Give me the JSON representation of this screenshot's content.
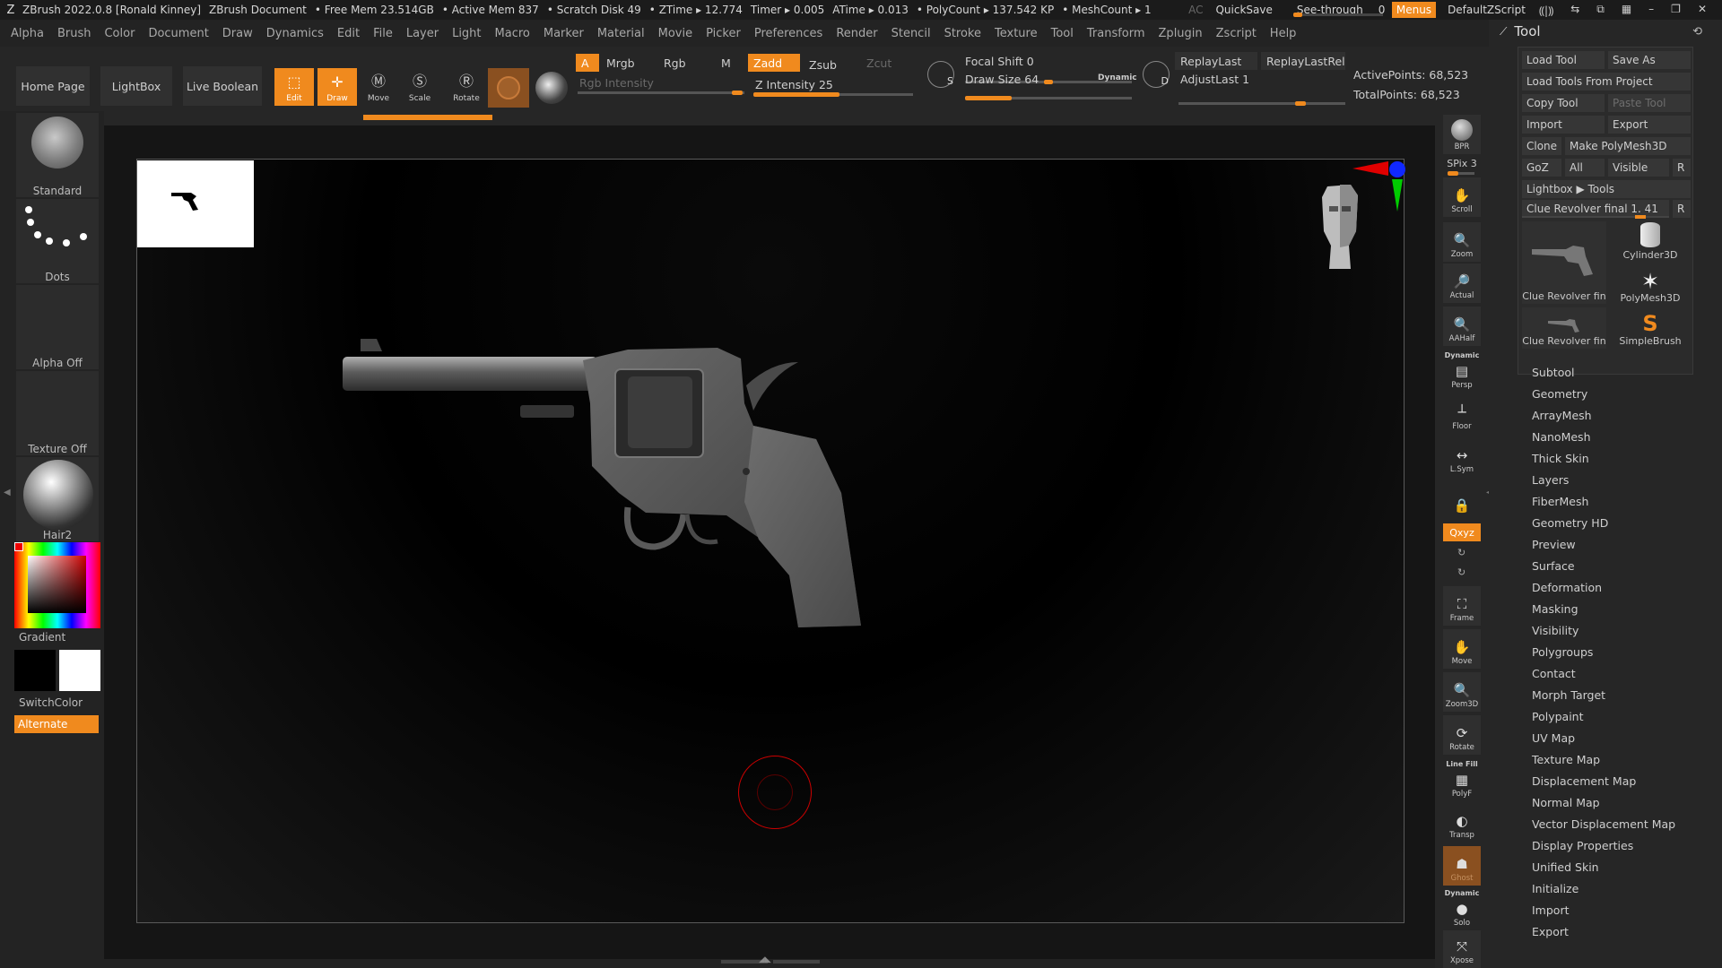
{
  "titlebar": {
    "app": "ZBrush 2022.0.8 [Ronald Kinney]",
    "document": "ZBrush Document",
    "free_mem": "• Free Mem 23.514GB",
    "active_mem": "• Active Mem 837",
    "scratch_disk": "• Scratch Disk 49",
    "ztime": "• ZTime ▸ 12.774",
    "timer": "Timer ▸ 0.005",
    "atime": "ATime ▸ 0.013",
    "polycount": "• PolyCount ▸ 137.542 KP",
    "meshcount": "• MeshCount ▸ 1",
    "ac": "AC",
    "quicksave": "QuickSave",
    "see_through_label": "See-through",
    "see_through_value": "0",
    "menus": "Menus",
    "zscript": "DefaultZScript"
  },
  "menubar": [
    "Alpha",
    "Brush",
    "Color",
    "Document",
    "Draw",
    "Dynamics",
    "Edit",
    "File",
    "Layer",
    "Light",
    "Macro",
    "Marker",
    "Material",
    "Movie",
    "Picker",
    "Preferences",
    "Render",
    "Stencil",
    "Stroke",
    "Texture",
    "Tool",
    "Transform",
    "Zplugin",
    "Zscript",
    "Help"
  ],
  "shelf": {
    "home_page": "Home Page",
    "lightbox": "LightBox",
    "live_boolean": "Live Boolean",
    "edit": "Edit",
    "draw": "Draw",
    "move": "Move",
    "scale": "Scale",
    "rotate": "Rotate",
    "a": "A",
    "mrgb": "Mrgb",
    "rgb": "Rgb",
    "m": "M",
    "zadd": "Zadd",
    "zsub": "Zsub",
    "zcut": "Zcut",
    "rgb_intensity": "Rgb Intensity",
    "z_intensity_label": "Z Intensity",
    "z_intensity": "25",
    "focal_shift_label": "Focal Shift",
    "focal_shift": "0",
    "draw_size_label": "Draw Size",
    "draw_size": "64",
    "dynamic": "Dynamic",
    "replay_last": "ReplayLast",
    "replay_last_rel": "ReplayLastRel",
    "adjust_last_label": "AdjustLast",
    "adjust_last": "1",
    "active_points": "ActivePoints: 68,523",
    "total_points": "TotalPoints: 68,523",
    "s_key": "S",
    "d_key": "D"
  },
  "left": {
    "brush": "Standard",
    "stroke": "Dots",
    "alpha": "Alpha Off",
    "texture": "Texture Off",
    "material": "Hair2",
    "gradient": "Gradient",
    "switch_color": "SwitchColor",
    "alternate": "Alternate"
  },
  "right_nav": {
    "bpr": "BPR",
    "spix": "SPix 3",
    "scroll": "Scroll",
    "zoom": "Zoom",
    "actual": "Actual",
    "aahalf": "AAHalf",
    "dynamic": "Dynamic",
    "persp": "Persp",
    "floor": "Floor",
    "lsym": "L.Sym",
    "xyz": "Qxyz",
    "frame": "Frame",
    "move": "Move",
    "zoom3d": "Zoom3D",
    "rotate": "Rotate",
    "line_fill": "Line Fill",
    "polyf": "PolyF",
    "transp": "Transp",
    "ghost": "Ghost",
    "dynamic2": "Dynamic",
    "solo": "Solo",
    "xpose": "Xpose"
  },
  "tool": {
    "title": "Tool",
    "load_tool": "Load Tool",
    "save_as": "Save As",
    "load_from_project": "Load Tools From Project",
    "copy_tool": "Copy Tool",
    "paste_tool": "Paste Tool",
    "import": "Import",
    "export": "Export",
    "clone": "Clone",
    "make_polymesh": "Make PolyMesh3D",
    "goz": "GoZ",
    "all": "All",
    "visible": "Visible",
    "r": "R",
    "lightbox_tools": "Lightbox ▶ Tools",
    "current_tool": "Clue Revolver final 1. 41",
    "thumbs": [
      "Clue Revolver fin",
      "Cylinder3D",
      "PolyMesh3D",
      "Clue Revolver fin",
      "SimpleBrush"
    ],
    "subpalettes": [
      "Subtool",
      "Geometry",
      "ArrayMesh",
      "NanoMesh",
      "Thick Skin",
      "Layers",
      "FiberMesh",
      "Geometry HD",
      "Preview",
      "Surface",
      "Deformation",
      "Masking",
      "Visibility",
      "Polygroups",
      "Contact",
      "Morph Target",
      "Polypaint",
      "UV Map",
      "Texture Map",
      "Displacement Map",
      "Normal Map",
      "Vector Displacement Map",
      "Display Properties",
      "Unified Skin",
      "Initialize",
      "Import",
      "Export"
    ]
  },
  "colors": {
    "accent": "#f08a1e",
    "panel": "#262626",
    "canvas": "#000000"
  }
}
